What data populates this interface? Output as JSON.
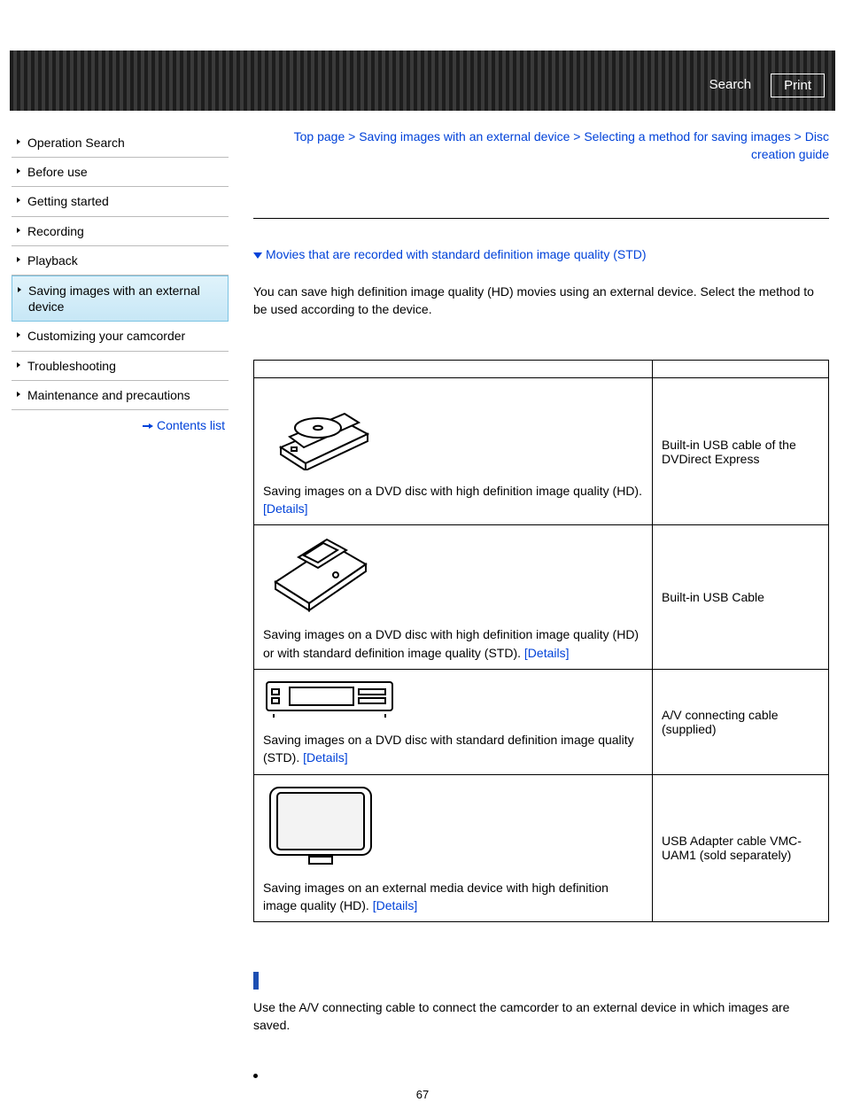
{
  "header": {
    "search": "Search",
    "print": "Print"
  },
  "sidebar": {
    "items": [
      "Operation Search",
      "Before use",
      "Getting started",
      "Recording",
      "Playback",
      "Saving images with an external device",
      "Customizing your camcorder",
      "Troubleshooting",
      "Maintenance and precautions"
    ],
    "active_index": 5,
    "contents_list": "Contents list"
  },
  "breadcrumb": {
    "parts": [
      "Top page",
      "Saving images with an external device",
      "Selecting a method for saving images",
      "Disc creation guide"
    ],
    "sep": " > "
  },
  "jump_link": "Movies that are recorded with standard definition image quality (STD)",
  "intro": "You can save high definition image quality (HD) movies using an external device. Select the method to be used according to the device.",
  "details_label": "[Details]",
  "table_rows": [
    {
      "desc": "Saving images on a DVD disc with high definition image quality (HD).",
      "details_inline": false,
      "cable": "Built-in USB cable of the DVDirect Express"
    },
    {
      "desc": "Saving images on a DVD disc with high definition image quality (HD) or with standard definition image quality (STD).",
      "details_inline": true,
      "cable": "Built-in USB Cable"
    },
    {
      "desc": "Saving images on a DVD disc with standard definition image quality (STD).",
      "details_inline": true,
      "cable": "A/V connecting cable (supplied)"
    },
    {
      "desc": "Saving images on an external media device with high definition image quality (HD).",
      "details_inline": true,
      "cable": "USB Adapter cable VMC-UAM1 (sold separately)"
    }
  ],
  "std_text": "Use the A/V connecting cable to connect the camcorder to an external device in which images are saved.",
  "page_number": "67"
}
